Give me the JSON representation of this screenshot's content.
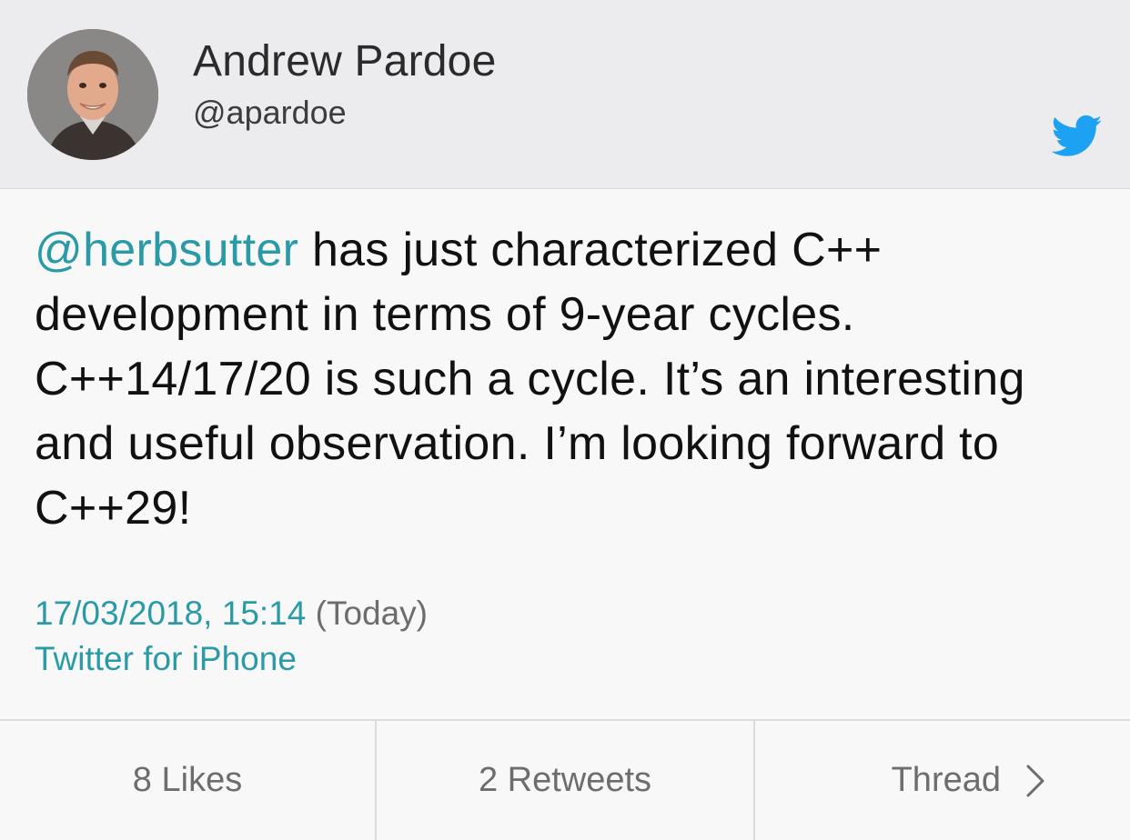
{
  "header": {
    "name": "Andrew Pardoe",
    "handle": "@apardoe",
    "avatar_icon": "avatar-photo",
    "brand_icon": "twitter-bird-icon",
    "brand_color": "#1da1f2"
  },
  "tweet": {
    "mention": "@herbsutter",
    "text": " has just characterized C++ development in terms of 9-year cycles. C++14/17/20 is such a cycle. It’s an interesting and useful observation. I’m looking forward to C++29!",
    "link_color": "#2a9ba6"
  },
  "meta": {
    "timestamp": "17/03/2018, 15:14",
    "relative": "(Today)",
    "client": "Twitter for iPhone"
  },
  "actions": {
    "likes_label": "8 Likes",
    "retweets_label": "2 Retweets",
    "thread_label": "Thread",
    "thread_icon": "chevron-right-icon"
  }
}
